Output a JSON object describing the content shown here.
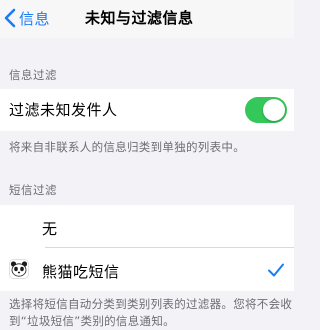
{
  "navbar": {
    "back_label": "信息",
    "title": "未知与过滤信息"
  },
  "message_filtering": {
    "header": "信息过滤",
    "filter_unknown_label": "过滤未知发件人",
    "filter_unknown_enabled": true,
    "footer": "将来自非联系人的信息归类到单独的列表中。"
  },
  "sms_filtering": {
    "header": "短信过滤",
    "options": [
      {
        "label": "无",
        "selected": false
      },
      {
        "label": "熊猫吃短信",
        "selected": true
      }
    ],
    "footer": "选择将短信自动分类到类别列表的过滤器。您将不会收到“垃圾短信”类别的信息通知。"
  },
  "colors": {
    "accent": "#1a7cf5",
    "toggle_on": "#34c759",
    "background": "#f2f2f7"
  },
  "icons": {
    "back": "chevron-left-icon",
    "panda": "panda-icon",
    "check": "checkmark-icon"
  }
}
